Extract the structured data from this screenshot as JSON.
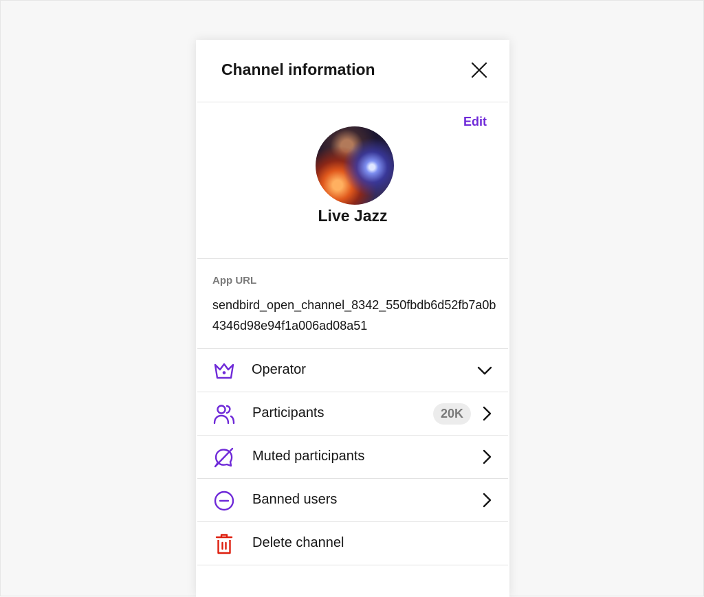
{
  "header": {
    "title": "Channel information",
    "close_icon": "close-icon"
  },
  "profile": {
    "edit_label": "Edit",
    "avatar_alt": "Live Jazz channel cover (guitarist on stage)",
    "channel_name": "Live Jazz"
  },
  "app_url": {
    "label": "App URL",
    "value": "sendbird_open_channel_8342_550fbdb6d52fb7a0b4346d98e94f1a006ad08a51"
  },
  "menu": [
    {
      "label": "Operator",
      "icon": "crown-icon",
      "trailing": "chevron-down-icon"
    },
    {
      "label": "Participants",
      "icon": "members-icon",
      "badge": "20K",
      "trailing": "chevron-right-icon"
    },
    {
      "label": "Muted participants",
      "icon": "mute-icon",
      "trailing": "chevron-right-icon"
    },
    {
      "label": "Banned users",
      "icon": "ban-icon",
      "trailing": "chevron-right-icon"
    },
    {
      "label": "Delete channel",
      "icon": "trash-icon"
    }
  ],
  "colors": {
    "accent": "#6f2ad8",
    "danger": "#de1f0f",
    "text_primary": "#161616",
    "text_secondary": "#7a7a7a",
    "badge_bg": "#ececec",
    "divider": "#e2e2e2",
    "page_bg": "#f7f7f7"
  }
}
